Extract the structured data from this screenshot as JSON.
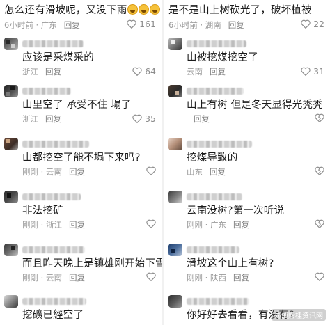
{
  "left": {
    "top": {
      "text": "怎么还有滑坡呢，又没下雨",
      "time": "6小时前",
      "loc": "广东",
      "reply": "回复",
      "likes": "161"
    },
    "comments": [
      {
        "text": "应该是采煤采的",
        "time": "",
        "loc": "浙江",
        "reply": "回复",
        "likes": "64"
      },
      {
        "text": "山里空了 承受不住 塌了",
        "time": "",
        "loc": "浙江",
        "reply": "回复",
        "likes": "35"
      },
      {
        "text": "山都挖空了能不塌下来吗?",
        "time": "刚刚",
        "loc": "云南",
        "reply": "回复",
        "likes": ""
      },
      {
        "text": "非法挖矿",
        "time": "刚刚",
        "loc": "浙江",
        "reply": "回复",
        "likes": ""
      },
      {
        "text": "而且昨天晚上是镇雄刚开始下雪",
        "time": "刚刚",
        "loc": "云南",
        "reply": "回复",
        "likes": ""
      },
      {
        "text": "挖礦已經空了",
        "time": "",
        "loc": "",
        "reply": "",
        "likes": ""
      }
    ]
  },
  "right": {
    "top": {
      "text": "是不是山上树砍光了，破坏植被",
      "time": "6小时前",
      "loc": "湖南",
      "reply": "回复",
      "likes": "22"
    },
    "comments": [
      {
        "text": "山被挖煤挖空了",
        "time": "",
        "loc": "云南",
        "reply": "回复",
        "likes": "31"
      },
      {
        "text": "山上有树 但是冬天显得光秃秃",
        "time": "",
        "loc": "",
        "reply": "回复",
        "likes": ""
      },
      {
        "text": "挖煤导致的",
        "time": "",
        "loc": "山东",
        "reply": "回复",
        "likes": ""
      },
      {
        "text": "云南没树?第一次听说",
        "time": "刚刚",
        "loc": "广东",
        "reply": "回复",
        "likes": ""
      },
      {
        "text": "滑坡这个山上有树?",
        "time": "刚刚",
        "loc": "陕西",
        "reply": "回复",
        "likes": ""
      },
      {
        "text": "你好好去看看，有没有?",
        "time": "",
        "loc": "",
        "reply": "",
        "likes": ""
      }
    ]
  },
  "watermark": "@滇黔桂资讯网"
}
